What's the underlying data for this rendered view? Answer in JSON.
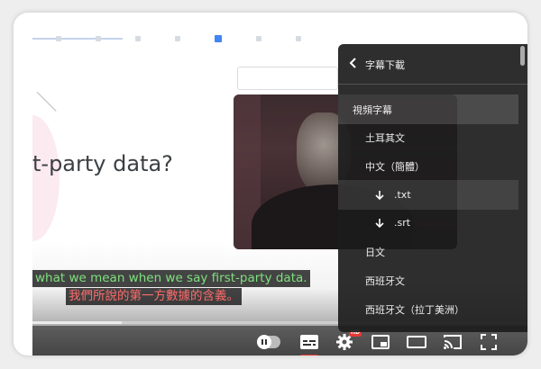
{
  "slide": {
    "title": "t-party data?"
  },
  "captions": {
    "english": "what we mean when we say first-party data.",
    "chinese": "我們所說的第一方數據的含義。"
  },
  "progress": {
    "loaded_fraction": 0.18
  },
  "menu": {
    "header": "字幕下載",
    "items": [
      {
        "label": "視頻字幕",
        "level": 0,
        "highlighted": true
      },
      {
        "label": "土耳其文",
        "level": 1
      },
      {
        "label": "中文（簡體）",
        "level": 1
      },
      {
        "label": ".txt",
        "level": 2,
        "icon": "download-arrow-icon",
        "highlighted": true
      },
      {
        "label": ".srt",
        "level": 2,
        "icon": "download-arrow-icon"
      },
      {
        "label": "日文",
        "level": 1
      },
      {
        "label": "西班牙文",
        "level": 1
      },
      {
        "label": "西班牙文（拉丁美洲）",
        "level": 1
      }
    ]
  },
  "controls": {
    "hd_badge": "HD",
    "icons": [
      "autoplay-toggle-icon",
      "subtitles-icon",
      "settings-gear-icon",
      "miniplayer-icon",
      "theater-mode-icon",
      "cast-icon",
      "fullscreen-icon"
    ]
  },
  "colors": {
    "caption_english": "#7ee07e",
    "caption_chinese": "#ff6b6b",
    "accent_red": "#e53935"
  }
}
